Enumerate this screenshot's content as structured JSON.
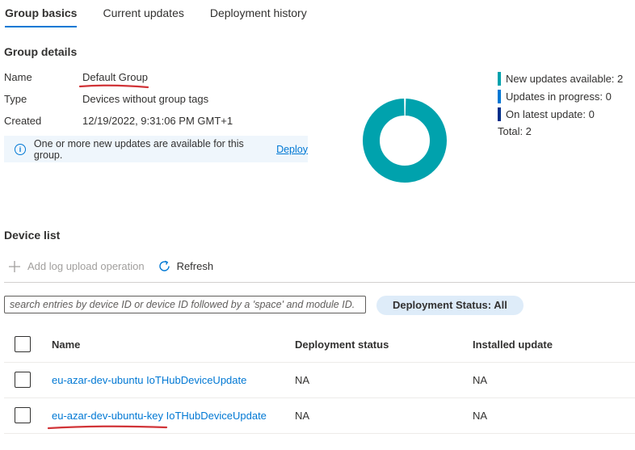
{
  "tabs": [
    {
      "label": "Group basics",
      "active": true
    },
    {
      "label": "Current updates",
      "active": false
    },
    {
      "label": "Deployment history",
      "active": false
    }
  ],
  "group_details": {
    "title": "Group details",
    "rows": [
      {
        "label": "Name",
        "value": "Default Group"
      },
      {
        "label": "Type",
        "value": "Devices without group tags"
      },
      {
        "label": "Created",
        "value": "12/19/2022, 9:31:06 PM GMT+1"
      }
    ],
    "info_message": "One or more new updates are available for this group.",
    "info_link": "Deploy"
  },
  "summary": {
    "legend": [
      {
        "label": "New updates available: 2",
        "color": "#00a2ad",
        "value": 2
      },
      {
        "label": "Updates in progress: 0",
        "color": "#0078d4",
        "value": 0
      },
      {
        "label": "On latest update: 0",
        "color": "#002e8a",
        "value": 0
      }
    ],
    "total_label": "Total: 2"
  },
  "device_list": {
    "title": "Device list",
    "toolbar": {
      "add_log_label": "Add log upload operation",
      "refresh_label": "Refresh"
    },
    "search_placeholder": "search entries by device ID or device ID followed by a 'space' and module ID.",
    "filter_pill": "Deployment Status: All",
    "columns": [
      "Name",
      "Deployment status",
      "Installed update"
    ],
    "rows": [
      {
        "name": "eu-azar-dev-ubuntu IoTHubDeviceUpdate",
        "status": "NA",
        "installed": "NA"
      },
      {
        "name": "eu-azar-dev-ubuntu-key IoTHubDeviceUpdate",
        "status": "NA",
        "installed": "NA"
      }
    ]
  },
  "colors": {
    "accent": "#0078d4",
    "annotation": "#d13438"
  }
}
